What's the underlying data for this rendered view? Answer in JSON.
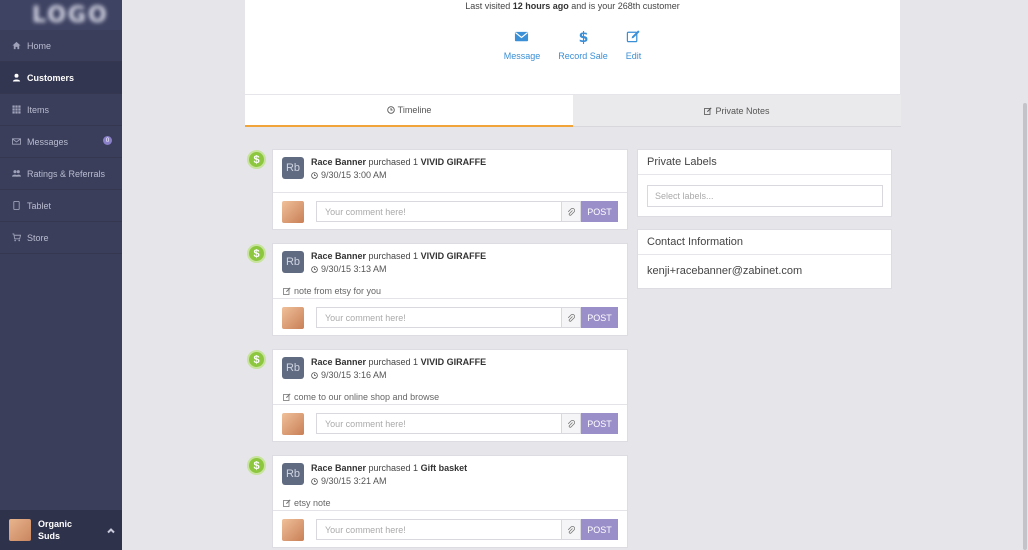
{
  "sidebar": {
    "logo_text": "LOGO",
    "items": [
      {
        "label": "Home",
        "icon": "home-icon"
      },
      {
        "label": "Customers",
        "icon": "user-icon"
      },
      {
        "label": "Items",
        "icon": "grid-icon"
      },
      {
        "label": "Messages",
        "icon": "envelope-icon",
        "badge": "0"
      },
      {
        "label": "Ratings & Referrals",
        "icon": "users-icon"
      },
      {
        "label": "Tablet",
        "icon": "tablet-icon"
      },
      {
        "label": "Store",
        "icon": "cart-icon"
      }
    ],
    "store_name": "Organic Suds"
  },
  "profile": {
    "last_visited_prefix": "Last visited ",
    "last_visited_bold": "12 hours ago",
    "last_visited_suffix": " and is your 268th customer",
    "actions": [
      {
        "label": "Message",
        "icon": "envelope-icon"
      },
      {
        "label": "Record Sale",
        "icon": "dollar-icon"
      },
      {
        "label": "Edit",
        "icon": "edit-icon"
      }
    ]
  },
  "tabs": [
    {
      "label": "Timeline",
      "icon": "clock-icon",
      "active": true
    },
    {
      "label": "Private Notes",
      "icon": "edit-icon",
      "active": false
    }
  ],
  "timeline": {
    "avatar_initials": "Rb",
    "comment_placeholder": "Your comment here!",
    "post_label": "POST",
    "events": [
      {
        "customer": "Race Banner",
        "action": " purchased 1 ",
        "item": "VIVID GIRAFFE",
        "time": "9/30/15 3:00 AM",
        "note": ""
      },
      {
        "customer": "Race Banner",
        "action": " purchased 1 ",
        "item": "VIVID GIRAFFE",
        "time": "9/30/15 3:13 AM",
        "note": "note from etsy for you"
      },
      {
        "customer": "Race Banner",
        "action": " purchased 1 ",
        "item": "VIVID GIRAFFE",
        "time": "9/30/15 3:16 AM",
        "note": "come to our online shop and browse"
      },
      {
        "customer": "Race Banner",
        "action": " purchased 1 ",
        "item": "Gift basket",
        "time": "9/30/15 3:21 AM",
        "note": "etsy note"
      }
    ]
  },
  "private_labels": {
    "title": "Private Labels",
    "placeholder": "Select labels..."
  },
  "contact": {
    "title": "Contact Information",
    "email": "kenji+racebanner@zabinet.com"
  },
  "colors": {
    "sidebar_bg": "#3b3e5a",
    "accent_blue": "#3a8fd6",
    "tab_active_border": "#f0a43a",
    "dollar_badge": "#8dc63f",
    "post_button": "#9b8fca"
  }
}
